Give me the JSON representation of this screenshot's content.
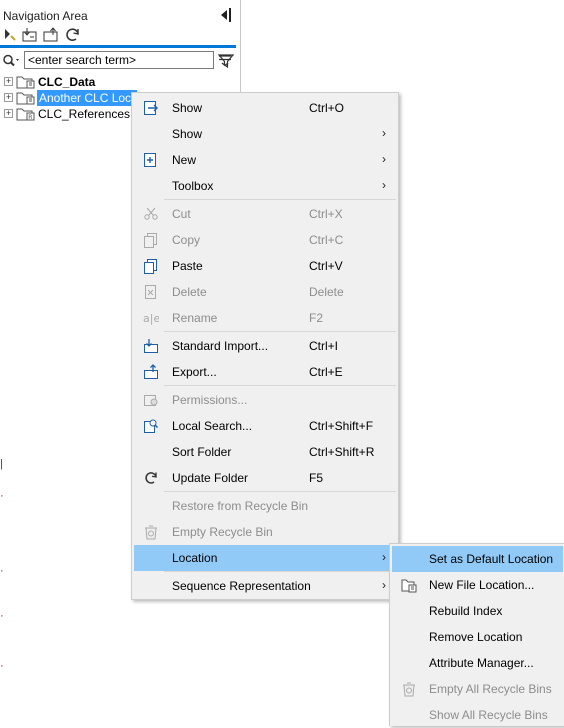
{
  "navigation": {
    "title": "Navigation Area",
    "search_placeholder": "<enter search term>",
    "tree": [
      {
        "label": "CLC_Data",
        "bold": true,
        "selected": false
      },
      {
        "label": "Another CLC Location",
        "bold": false,
        "selected": true
      },
      {
        "label": "CLC_References",
        "bold": false,
        "selected": false
      }
    ]
  },
  "context_menu": {
    "items": [
      {
        "label": "Show",
        "shortcut": "Ctrl+O",
        "submenu": false,
        "disabled": false
      },
      {
        "label": "Show",
        "shortcut": "",
        "submenu": true,
        "disabled": false
      },
      {
        "label": "New",
        "shortcut": "",
        "submenu": true,
        "disabled": false
      },
      {
        "label": "Toolbox",
        "shortcut": "",
        "submenu": true,
        "disabled": false
      },
      {
        "label": "Cut",
        "shortcut": "Ctrl+X",
        "submenu": false,
        "disabled": true
      },
      {
        "label": "Copy",
        "shortcut": "Ctrl+C",
        "submenu": false,
        "disabled": true
      },
      {
        "label": "Paste",
        "shortcut": "Ctrl+V",
        "submenu": false,
        "disabled": false
      },
      {
        "label": "Delete",
        "shortcut": "Delete",
        "submenu": false,
        "disabled": true
      },
      {
        "label": "Rename",
        "shortcut": "F2",
        "submenu": false,
        "disabled": true
      },
      {
        "label": "Standard Import...",
        "shortcut": "Ctrl+I",
        "submenu": false,
        "disabled": false
      },
      {
        "label": "Export...",
        "shortcut": "Ctrl+E",
        "submenu": false,
        "disabled": false
      },
      {
        "label": "Permissions...",
        "shortcut": "",
        "submenu": false,
        "disabled": true
      },
      {
        "label": "Local Search...",
        "shortcut": "Ctrl+Shift+F",
        "submenu": false,
        "disabled": false
      },
      {
        "label": "Sort Folder",
        "shortcut": "Ctrl+Shift+R",
        "submenu": false,
        "disabled": false
      },
      {
        "label": "Update Folder",
        "shortcut": "F5",
        "submenu": false,
        "disabled": false
      },
      {
        "label": "Restore from Recycle Bin",
        "shortcut": "",
        "submenu": false,
        "disabled": true
      },
      {
        "label": "Empty Recycle Bin",
        "shortcut": "",
        "submenu": false,
        "disabled": true
      },
      {
        "label": "Location",
        "shortcut": "",
        "submenu": true,
        "disabled": false,
        "highlighted": true
      },
      {
        "label": "Sequence Representation",
        "shortcut": "",
        "submenu": true,
        "disabled": false
      }
    ]
  },
  "location_submenu": {
    "items": [
      {
        "label": "Set as Default Location",
        "disabled": false,
        "highlighted": true
      },
      {
        "label": "New File Location...",
        "disabled": false
      },
      {
        "label": "Rebuild Index",
        "disabled": false
      },
      {
        "label": "Remove Location",
        "disabled": false
      },
      {
        "label": "Attribute Manager...",
        "disabled": false
      },
      {
        "label": "Empty All Recycle Bins",
        "disabled": true
      },
      {
        "label": "Show All Recycle Bins",
        "disabled": true
      }
    ]
  },
  "colors": {
    "highlight": "#91c9f7",
    "accent_line": "#0078d7",
    "selection": "#3399ff",
    "disabled_text": "#8d8d8d",
    "menu_bg": "#f0f0f0"
  }
}
